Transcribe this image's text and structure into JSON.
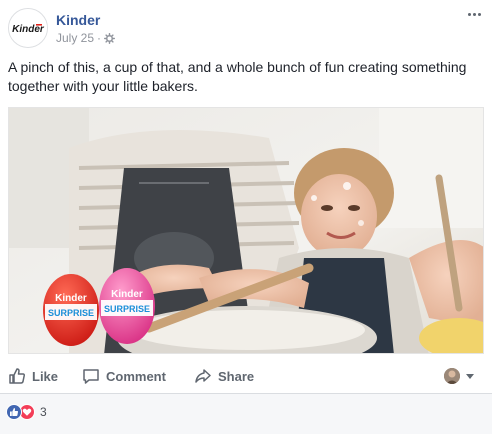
{
  "post": {
    "page_name": "Kinder",
    "logo_text": "Kinder",
    "date": "July 25",
    "separator": "·",
    "audience_icon": "globe-gear-icon",
    "more_icon": "more-options-icon",
    "message": "A pinch of this, a cup of that, and a whole bunch of fun creating something together with your little bakers."
  },
  "media": {
    "egg_brand": "Kinder",
    "egg_product": "SURPRISE",
    "egg_colors": [
      "#e32119",
      "#e8409a"
    ]
  },
  "actions": {
    "like_label": "Like",
    "comment_label": "Comment",
    "share_label": "Share"
  },
  "reactions": {
    "types": [
      "like",
      "love"
    ],
    "count": "3"
  },
  "colors": {
    "link_blue": "#365899",
    "meta_gray": "#90949c",
    "action_gray": "#606770",
    "like_blue": "#4267b2",
    "love_red": "#f33e58"
  }
}
